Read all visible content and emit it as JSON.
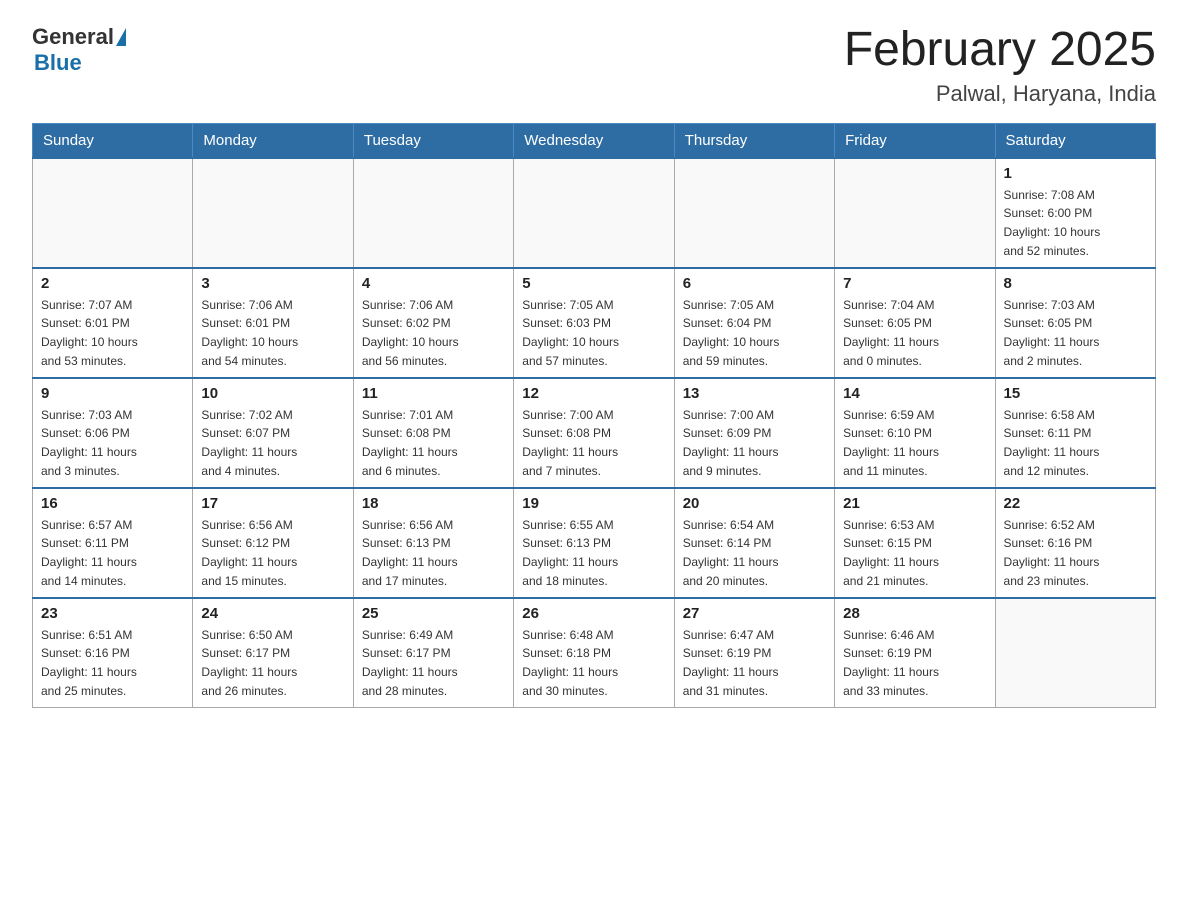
{
  "header": {
    "logo_general": "General",
    "logo_blue": "Blue",
    "month_title": "February 2025",
    "location": "Palwal, Haryana, India"
  },
  "days_of_week": [
    "Sunday",
    "Monday",
    "Tuesday",
    "Wednesday",
    "Thursday",
    "Friday",
    "Saturday"
  ],
  "weeks": [
    [
      {
        "day": "",
        "info": ""
      },
      {
        "day": "",
        "info": ""
      },
      {
        "day": "",
        "info": ""
      },
      {
        "day": "",
        "info": ""
      },
      {
        "day": "",
        "info": ""
      },
      {
        "day": "",
        "info": ""
      },
      {
        "day": "1",
        "info": "Sunrise: 7:08 AM\nSunset: 6:00 PM\nDaylight: 10 hours\nand 52 minutes."
      }
    ],
    [
      {
        "day": "2",
        "info": "Sunrise: 7:07 AM\nSunset: 6:01 PM\nDaylight: 10 hours\nand 53 minutes."
      },
      {
        "day": "3",
        "info": "Sunrise: 7:06 AM\nSunset: 6:01 PM\nDaylight: 10 hours\nand 54 minutes."
      },
      {
        "day": "4",
        "info": "Sunrise: 7:06 AM\nSunset: 6:02 PM\nDaylight: 10 hours\nand 56 minutes."
      },
      {
        "day": "5",
        "info": "Sunrise: 7:05 AM\nSunset: 6:03 PM\nDaylight: 10 hours\nand 57 minutes."
      },
      {
        "day": "6",
        "info": "Sunrise: 7:05 AM\nSunset: 6:04 PM\nDaylight: 10 hours\nand 59 minutes."
      },
      {
        "day": "7",
        "info": "Sunrise: 7:04 AM\nSunset: 6:05 PM\nDaylight: 11 hours\nand 0 minutes."
      },
      {
        "day": "8",
        "info": "Sunrise: 7:03 AM\nSunset: 6:05 PM\nDaylight: 11 hours\nand 2 minutes."
      }
    ],
    [
      {
        "day": "9",
        "info": "Sunrise: 7:03 AM\nSunset: 6:06 PM\nDaylight: 11 hours\nand 3 minutes."
      },
      {
        "day": "10",
        "info": "Sunrise: 7:02 AM\nSunset: 6:07 PM\nDaylight: 11 hours\nand 4 minutes."
      },
      {
        "day": "11",
        "info": "Sunrise: 7:01 AM\nSunset: 6:08 PM\nDaylight: 11 hours\nand 6 minutes."
      },
      {
        "day": "12",
        "info": "Sunrise: 7:00 AM\nSunset: 6:08 PM\nDaylight: 11 hours\nand 7 minutes."
      },
      {
        "day": "13",
        "info": "Sunrise: 7:00 AM\nSunset: 6:09 PM\nDaylight: 11 hours\nand 9 minutes."
      },
      {
        "day": "14",
        "info": "Sunrise: 6:59 AM\nSunset: 6:10 PM\nDaylight: 11 hours\nand 11 minutes."
      },
      {
        "day": "15",
        "info": "Sunrise: 6:58 AM\nSunset: 6:11 PM\nDaylight: 11 hours\nand 12 minutes."
      }
    ],
    [
      {
        "day": "16",
        "info": "Sunrise: 6:57 AM\nSunset: 6:11 PM\nDaylight: 11 hours\nand 14 minutes."
      },
      {
        "day": "17",
        "info": "Sunrise: 6:56 AM\nSunset: 6:12 PM\nDaylight: 11 hours\nand 15 minutes."
      },
      {
        "day": "18",
        "info": "Sunrise: 6:56 AM\nSunset: 6:13 PM\nDaylight: 11 hours\nand 17 minutes."
      },
      {
        "day": "19",
        "info": "Sunrise: 6:55 AM\nSunset: 6:13 PM\nDaylight: 11 hours\nand 18 minutes."
      },
      {
        "day": "20",
        "info": "Sunrise: 6:54 AM\nSunset: 6:14 PM\nDaylight: 11 hours\nand 20 minutes."
      },
      {
        "day": "21",
        "info": "Sunrise: 6:53 AM\nSunset: 6:15 PM\nDaylight: 11 hours\nand 21 minutes."
      },
      {
        "day": "22",
        "info": "Sunrise: 6:52 AM\nSunset: 6:16 PM\nDaylight: 11 hours\nand 23 minutes."
      }
    ],
    [
      {
        "day": "23",
        "info": "Sunrise: 6:51 AM\nSunset: 6:16 PM\nDaylight: 11 hours\nand 25 minutes."
      },
      {
        "day": "24",
        "info": "Sunrise: 6:50 AM\nSunset: 6:17 PM\nDaylight: 11 hours\nand 26 minutes."
      },
      {
        "day": "25",
        "info": "Sunrise: 6:49 AM\nSunset: 6:17 PM\nDaylight: 11 hours\nand 28 minutes."
      },
      {
        "day": "26",
        "info": "Sunrise: 6:48 AM\nSunset: 6:18 PM\nDaylight: 11 hours\nand 30 minutes."
      },
      {
        "day": "27",
        "info": "Sunrise: 6:47 AM\nSunset: 6:19 PM\nDaylight: 11 hours\nand 31 minutes."
      },
      {
        "day": "28",
        "info": "Sunrise: 6:46 AM\nSunset: 6:19 PM\nDaylight: 11 hours\nand 33 minutes."
      },
      {
        "day": "",
        "info": ""
      }
    ]
  ]
}
